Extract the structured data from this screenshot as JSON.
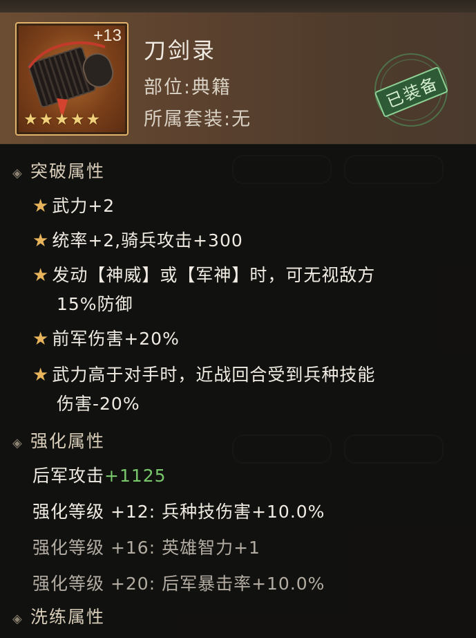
{
  "item": {
    "name": "刀剑录",
    "enhance_level": "+13",
    "stars": "★★★★★",
    "slot_text": "部位:典籍",
    "set_text": "所属套装:无",
    "equipped_label": "已装备"
  },
  "breakthrough": {
    "title": "突破属性",
    "lines": [
      "武力+2",
      "统率+2,骑兵攻击+300",
      "发动【神威】或【军神】时，可无视敌方",
      "15%防御",
      "前军伤害+20%",
      "武力高于对手时，近战回合受到兵种技能",
      "伤害-20%"
    ]
  },
  "enhance": {
    "title": "强化属性",
    "base_label": "后军攻击",
    "base_value": "+1125",
    "lines": [
      "强化等级 +12: 兵种技伤害+10.0%",
      "强化等级 +16: 英雄智力+1",
      "强化等级 +20: 后军暴击率+10.0%"
    ]
  },
  "next_section_partial": "洗练属性",
  "colors": {
    "header_bg": "#5a412e",
    "accent_gold": "#e8b55c",
    "value_green": "#79c86b",
    "seal_green": "#5f9a63"
  }
}
